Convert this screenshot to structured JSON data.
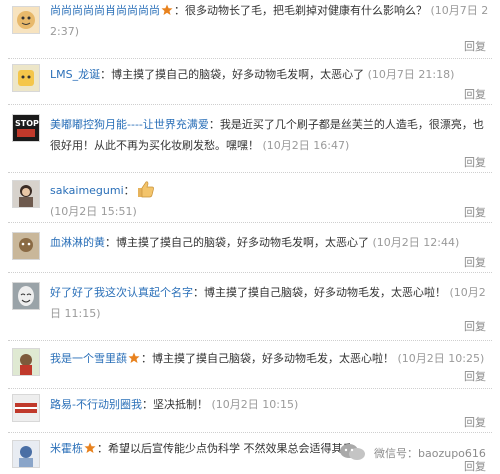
{
  "comments": [
    {
      "user": "尚尚尚尚尚肖尚尚尚尚",
      "sep1": "：",
      "body": "很多动物长了毛，把毛剃掉对健康有什么影响么？",
      "time": "(10月7日 22:37)",
      "reply": "回复"
    },
    {
      "user": "LMS_龙诞",
      "sep1": "：",
      "body": "博主摸了摸自己的脑袋，好多动物毛发啊，太恶心了",
      "time": "(10月7日 21:18)",
      "reply": "回复"
    },
    {
      "user": "美嘟嘟控狗月能----让世界充满爱",
      "sep1": "：",
      "body": "我是近买了几个刷子都是丝芙兰的人造毛，很漂亮，也很好用！从此不再为买化妆刷发愁。嘿嘿！",
      "time": "(10月2日 16:47)",
      "reply": "回复",
      "avatar_text": "STOP!"
    },
    {
      "user": "sakaimegumi",
      "sep1": "：",
      "body": "",
      "time": "(10月2日 15:51)",
      "reply": "回复"
    },
    {
      "user": "血淋淋的黄",
      "sep1": "：",
      "body": "博主摸了摸自己的脑袋，好多动物毛发啊，太恶心了",
      "time": "(10月2日 12:44)",
      "reply": "回复"
    },
    {
      "user": "好了好了我这次认真起个名字",
      "sep1": "：",
      "body": "博主摸了摸自己脑袋，好多动物毛发，太恶心啦！",
      "time": "(10月2日 11:15)",
      "reply": "回复"
    },
    {
      "user": "我是一个雪里蕻",
      "sep1": "：",
      "body": "博主摸了摸自己脑袋，好多动物毛发，太恶心啦！",
      "time": "(10月2日 10:25)",
      "reply": "回复"
    },
    {
      "user": "路易-不行动别圈我",
      "sep1": "：",
      "body": "坚决抵制！",
      "time": "(10月2日 10:15)",
      "reply": "回复"
    },
    {
      "user": "米霍栋",
      "sep1": "：",
      "body": "希望以后宣传能少点伪科学 不然效果总会适得其反",
      "time": "",
      "reply": "回复"
    }
  ],
  "watermark": {
    "text": "微信号：baozupo616",
    "icon": "wechat-icon"
  },
  "colors": {
    "username": "#2a6fb8",
    "time": "#9a9a9a",
    "star": "#e8821e"
  }
}
